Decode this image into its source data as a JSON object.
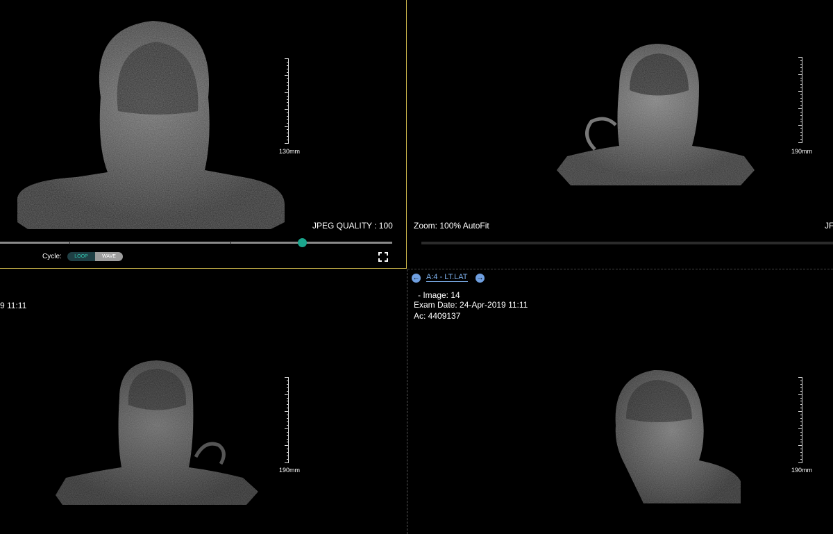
{
  "viewports": [
    {
      "id": "vp1",
      "ruler_label": "130mm",
      "jpeg_quality": "JPEG QUALITY : 100",
      "slider_value": 0.77,
      "cycle_label": "Cycle:",
      "cycle_options": [
        "LOOP",
        "WAVE"
      ],
      "cycle_selected": "LOOP"
    },
    {
      "id": "vp2",
      "ruler_label": "190mm",
      "zoom": "Zoom: 100% AutoFit",
      "partial_text": "JF"
    },
    {
      "id": "vp3",
      "ruler_label": "190mm",
      "partial_date": "9 11:11"
    },
    {
      "id": "vp4",
      "ruler_label": "190mm",
      "series": "A:4 - LT.LAT",
      "image": "- Image: 14",
      "exam_date": "Exam Date: 24-Apr-2019 11:11",
      "accession": "Ac: 4409137"
    }
  ],
  "icons": {
    "prev": "arrow-left-circle-icon",
    "next": "arrow-right-circle-icon",
    "fullscreen": "fullscreen-icon"
  },
  "colors": {
    "active_border": "#c8b34a",
    "accent": "#1aa58c",
    "link": "#7fb2ef"
  }
}
